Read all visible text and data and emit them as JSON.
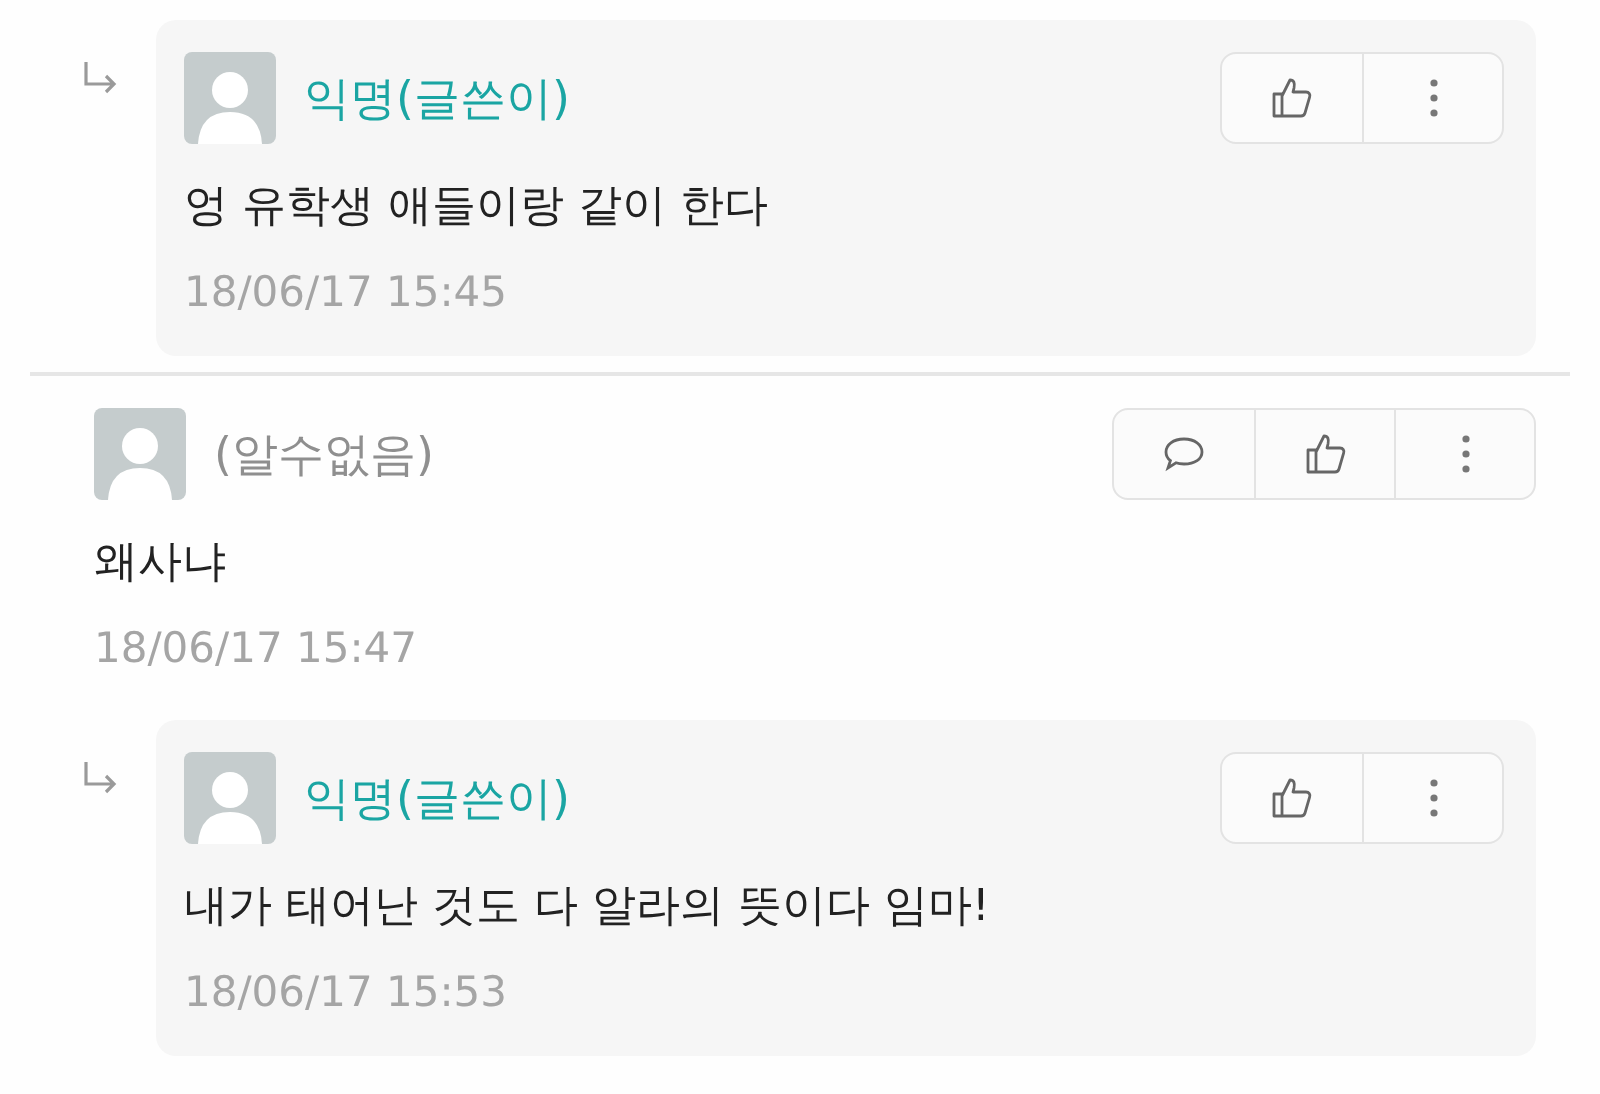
{
  "comments": [
    {
      "kind": "reply",
      "author": "익명(글쓴이)",
      "is_author": true,
      "text": "엉 유학생 애들이랑 같이 한다",
      "time": "18/06/17 15:45",
      "actions": [
        {
          "kind": "like"
        },
        {
          "kind": "more"
        }
      ]
    },
    {
      "kind": "comment",
      "author": "(알수없음)",
      "is_author": false,
      "text": "왜사냐",
      "time": "18/06/17 15:47",
      "actions": [
        {
          "kind": "reply"
        },
        {
          "kind": "like"
        },
        {
          "kind": "more"
        }
      ]
    },
    {
      "kind": "reply",
      "author": "익명(글쓴이)",
      "is_author": true,
      "text": "내가 태어난 것도 다 알라의 뜻이다 임마!",
      "time": "18/06/17 15:53",
      "actions": [
        {
          "kind": "like"
        },
        {
          "kind": "more"
        }
      ]
    }
  ]
}
